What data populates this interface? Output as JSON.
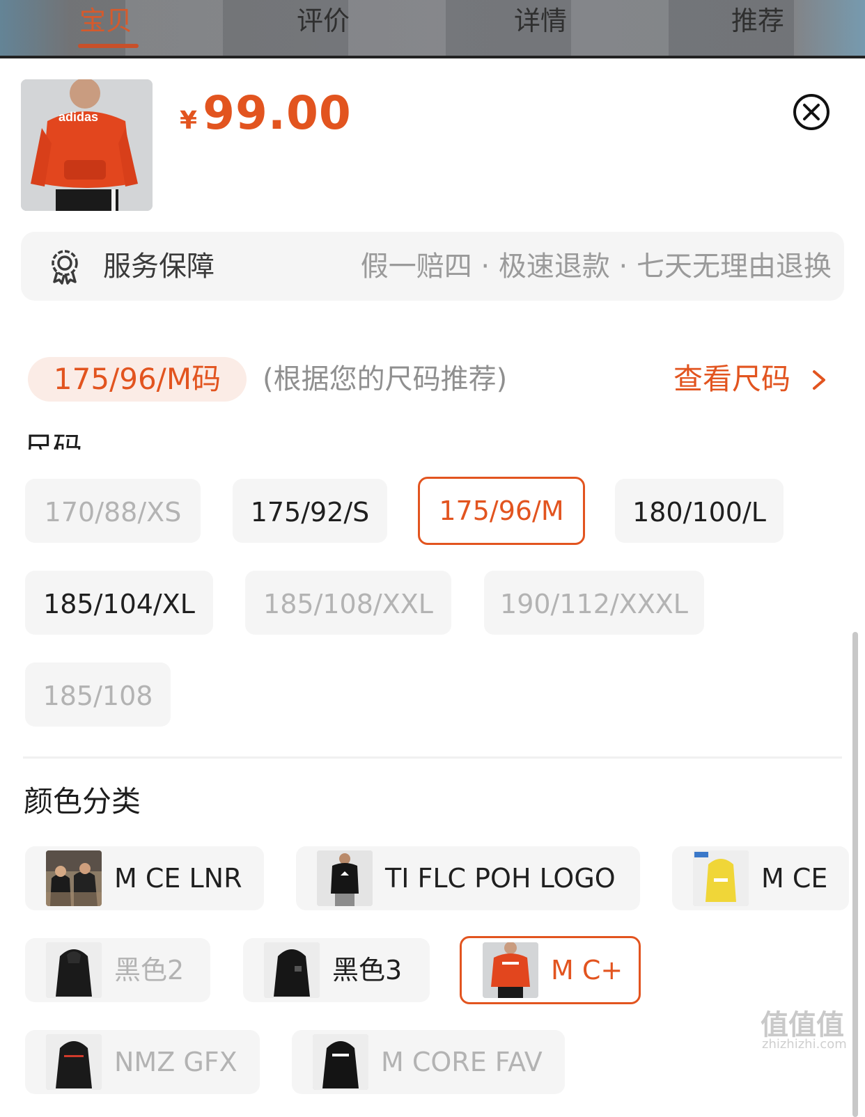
{
  "top_tabs": {
    "items": [
      {
        "label": "宝贝",
        "active": true
      },
      {
        "label": "评价",
        "active": false
      },
      {
        "label": "详情",
        "active": false
      },
      {
        "label": "推荐",
        "active": false
      }
    ]
  },
  "product": {
    "currency": "¥",
    "price": "99.00"
  },
  "service": {
    "label": "服务保障",
    "description": "假一赔四 · 极速退款 · 七天无理由退换"
  },
  "recommendation": {
    "size": "175/96/M码",
    "note": "(根据您的尺码推荐)",
    "link": "查看尺码"
  },
  "size_section": {
    "title": "尺码",
    "options": [
      {
        "label": "170/88/XS",
        "state": "disabled"
      },
      {
        "label": "175/92/S",
        "state": "normal"
      },
      {
        "label": "175/96/M",
        "state": "selected"
      },
      {
        "label": "180/100/L",
        "state": "normal"
      },
      {
        "label": "185/104/XL",
        "state": "normal"
      },
      {
        "label": "185/108/XXL",
        "state": "disabled"
      },
      {
        "label": "190/112/XXXL",
        "state": "disabled"
      },
      {
        "label": "185/108",
        "state": "disabled"
      }
    ]
  },
  "color_section": {
    "title": "颜色分类",
    "options": [
      {
        "label": "M CE LNR",
        "state": "normal"
      },
      {
        "label": "TI FLC POH LOGO",
        "state": "normal"
      },
      {
        "label": "M CE",
        "state": "normal"
      },
      {
        "label": "黑色2",
        "state": "disabled"
      },
      {
        "label": "黑色3",
        "state": "normal"
      },
      {
        "label": "M C+",
        "state": "selected"
      },
      {
        "label": "NMZ GFX",
        "state": "disabled"
      },
      {
        "label": "M CORE FAV",
        "state": "disabled"
      }
    ]
  },
  "watermark": {
    "text": "值值值",
    "sub": "zhizhizhi.com"
  },
  "colors": {
    "accent": "#e2541f",
    "disabled_text": "#b3b3b3",
    "option_bg": "#f5f5f5"
  }
}
